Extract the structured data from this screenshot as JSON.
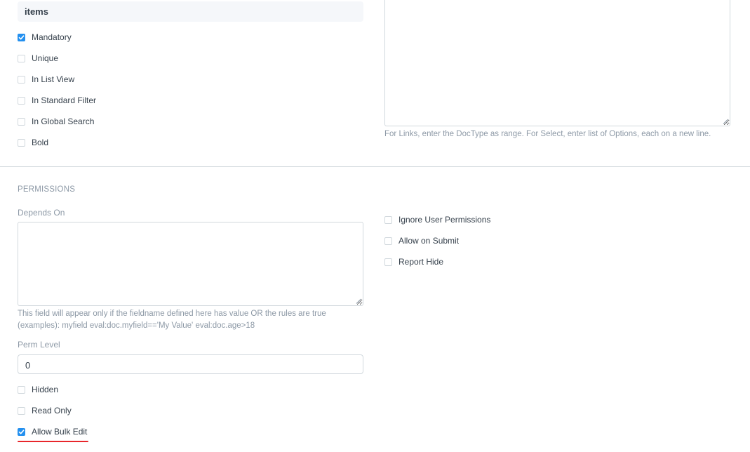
{
  "section_title": "items",
  "properties": {
    "mandatory": "Mandatory",
    "unique": "Unique",
    "in_list_view": "In List View",
    "in_standard_filter": "In Standard Filter",
    "in_global_search": "In Global Search",
    "bold": "Bold"
  },
  "options_help": "For Links, enter the DocType as range. For Select, enter list of Options, each on a new line.",
  "permissions": {
    "heading": "PERMISSIONS",
    "depends_on_label": "Depends On",
    "depends_on_help_line1": "This field will appear only if the fieldname defined here has value OR the rules are true",
    "depends_on_help_line2": "(examples): myfield eval:doc.myfield=='My Value' eval:doc.age>18",
    "perm_level_label": "Perm Level",
    "perm_level_value": "0",
    "hidden": "Hidden",
    "read_only": "Read Only",
    "allow_bulk_edit": "Allow Bulk Edit",
    "ignore_user_permissions": "Ignore User Permissions",
    "allow_on_submit": "Allow on Submit",
    "report_hide": "Report Hide"
  },
  "colors": {
    "accent": "#2490ef",
    "highlight_underline": "#e8262b"
  }
}
